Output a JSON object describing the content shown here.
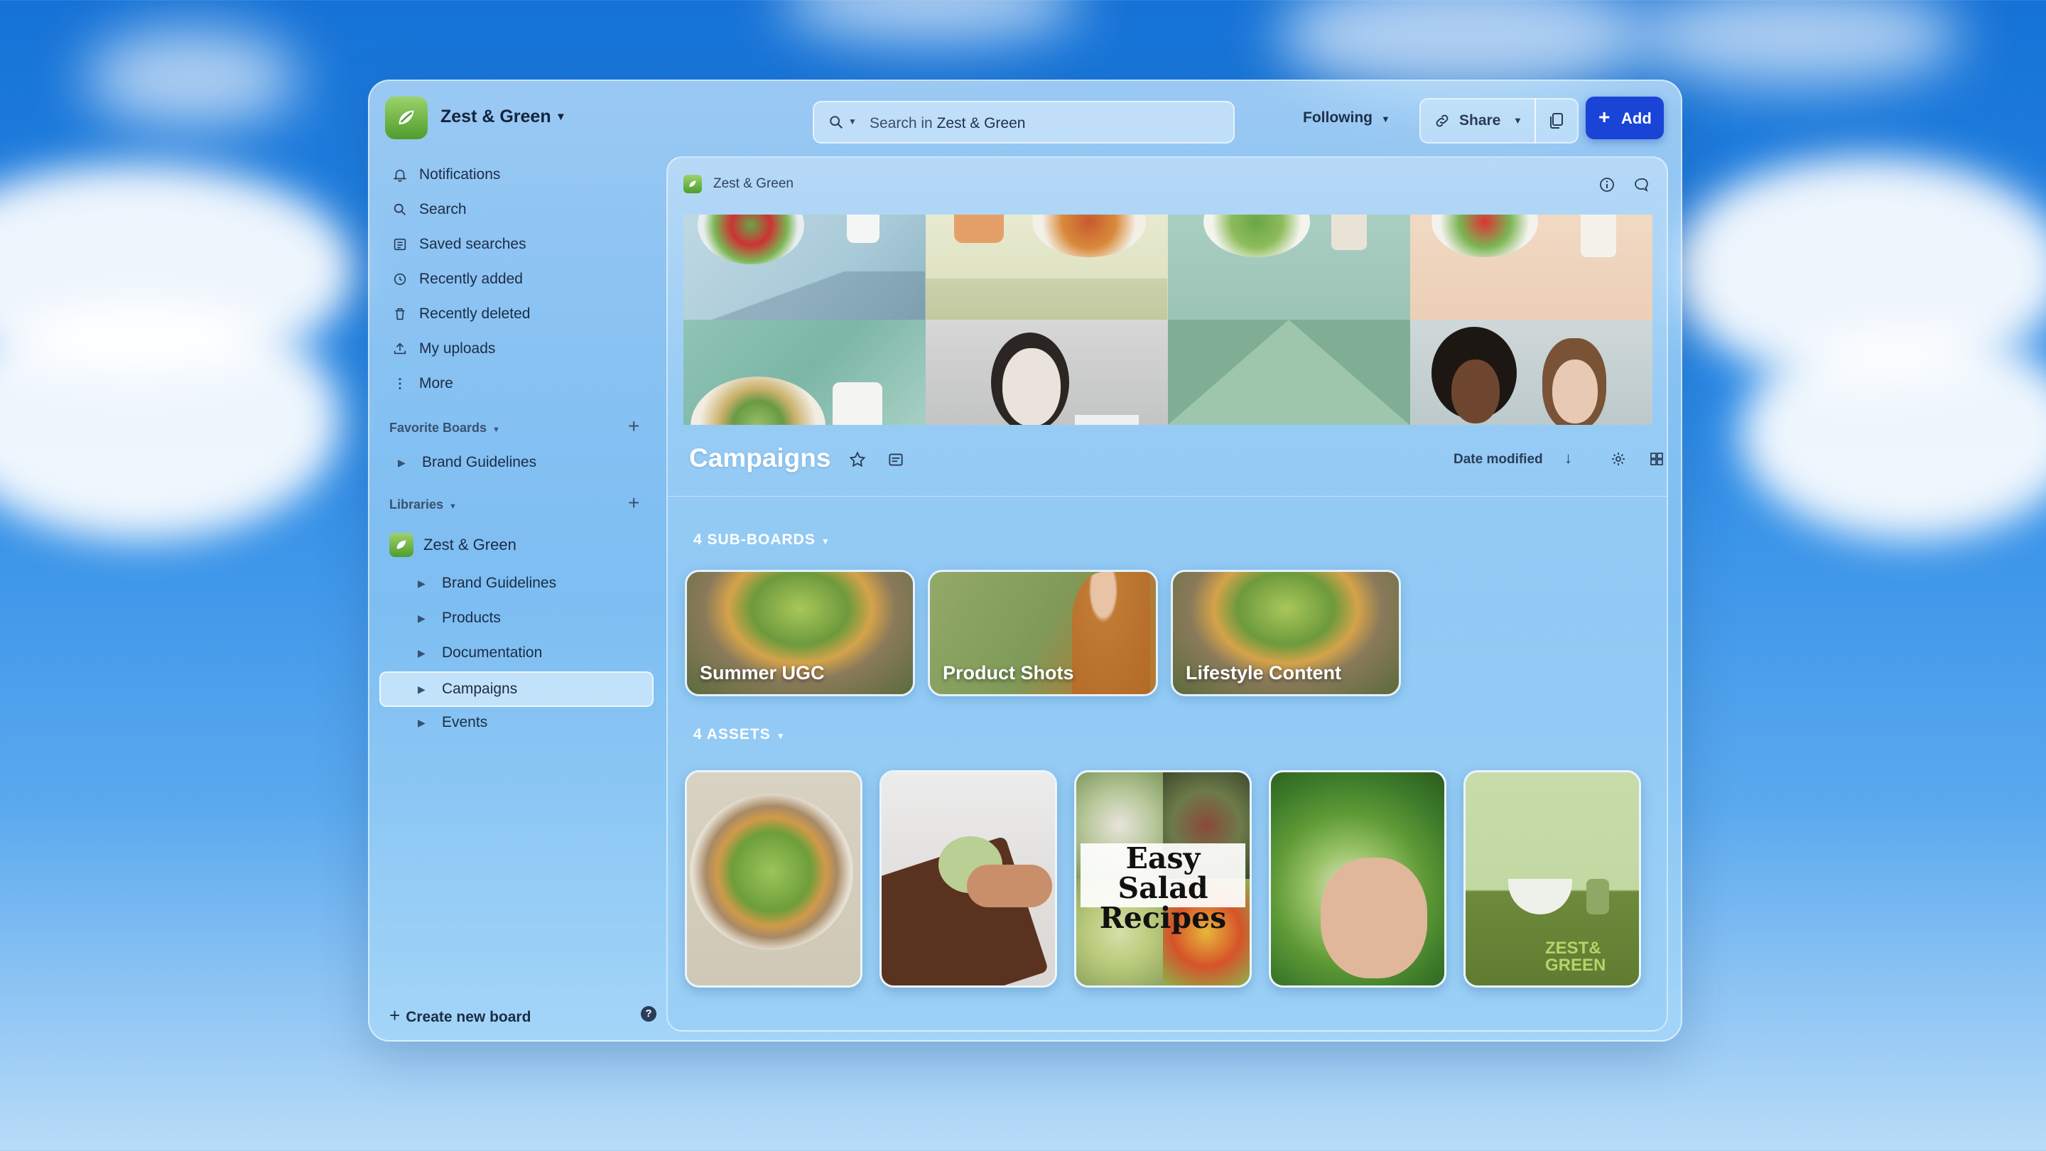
{
  "workspace": {
    "name": "Zest & Green"
  },
  "search": {
    "prefix": "Search in",
    "scope": "Zest & Green"
  },
  "topbar": {
    "following": "Following",
    "share": "Share",
    "add": "Add"
  },
  "sidebar": {
    "nav": [
      {
        "label": "Notifications",
        "icon": "bell-icon"
      },
      {
        "label": "Search",
        "icon": "search-icon"
      },
      {
        "label": "Saved searches",
        "icon": "saved-search-icon"
      },
      {
        "label": "Recently added",
        "icon": "clock-icon"
      },
      {
        "label": "Recently deleted",
        "icon": "trash-icon"
      },
      {
        "label": "My uploads",
        "icon": "upload-icon"
      },
      {
        "label": "More",
        "icon": "more-vertical-icon"
      }
    ],
    "favorites_label": "Favorite Boards",
    "favorites": [
      {
        "label": "Brand Guidelines"
      }
    ],
    "libraries_label": "Libraries",
    "library_name": "Zest & Green",
    "library_items": [
      {
        "label": "Brand Guidelines"
      },
      {
        "label": "Products"
      },
      {
        "label": "Documentation"
      },
      {
        "label": "Campaigns",
        "selected": true
      },
      {
        "label": "Events"
      }
    ],
    "create_board": "Create new board",
    "help": "?"
  },
  "main": {
    "breadcrumb": "Zest & Green",
    "title": "Campaigns",
    "sort_label": "Date modified",
    "subboards_label": "4 SUB-BOARDS",
    "subboards": [
      {
        "label": "Summer UGC"
      },
      {
        "label": "Product Shots"
      },
      {
        "label": "Lifestyle Content"
      }
    ],
    "assets_label": "4 ASSETS",
    "asset_text": {
      "line1": "Easy Salad",
      "line2": "Recipes"
    },
    "asset_logo": {
      "line1": "ZEST&",
      "line2": "GREEN"
    }
  },
  "colors": {
    "accent": "#1a44d6",
    "brand_green": "#4f9c2e"
  }
}
